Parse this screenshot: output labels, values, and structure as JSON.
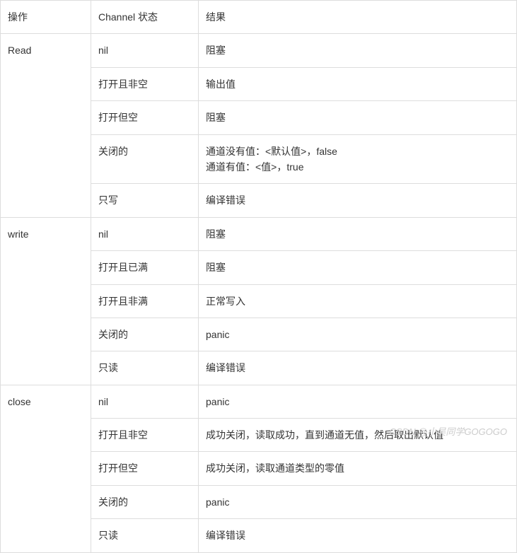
{
  "table": {
    "headers": {
      "operation": "操作",
      "channelState": "Channel 状态",
      "result": "结果"
    },
    "groups": [
      {
        "op": "Read",
        "rows": [
          {
            "state": "nil",
            "result": "阻塞"
          },
          {
            "state": "打开且非空",
            "result": "输出值"
          },
          {
            "state": "打开但空",
            "result": "阻塞"
          },
          {
            "state": "关闭的",
            "result": "通道没有值：<默认值>，false\n通道有值：<值>，true"
          },
          {
            "state": "只写",
            "result": "编译错误"
          }
        ]
      },
      {
        "op": "write",
        "rows": [
          {
            "state": "nil",
            "result": "阻塞"
          },
          {
            "state": "打开且已满",
            "result": "阻塞"
          },
          {
            "state": "打开且非满",
            "result": "正常写入"
          },
          {
            "state": "关闭的",
            "result": "panic"
          },
          {
            "state": "只读",
            "result": "编译错误"
          }
        ]
      },
      {
        "op": "close",
        "rows": [
          {
            "state": "nil",
            "result": "panic"
          },
          {
            "state": "打开且非空",
            "result": "成功关闭，读取成功，直到通道无值，然后取出默认值"
          },
          {
            "state": "打开但空",
            "result": "成功关闭，读取通道类型的零值"
          },
          {
            "state": "关闭的",
            "result": "panic"
          },
          {
            "state": "只读",
            "result": "编译错误"
          }
        ]
      }
    ]
  },
  "watermark": "CSDN @小吴同学GOGOGO"
}
